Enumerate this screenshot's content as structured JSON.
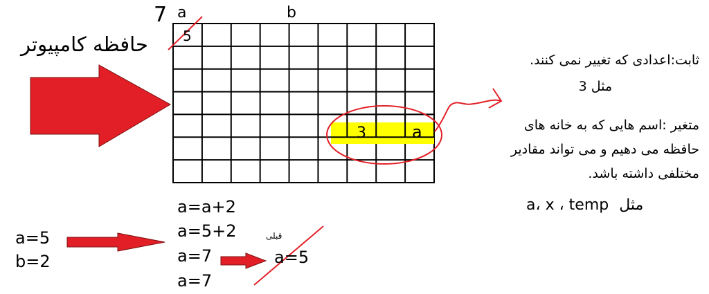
{
  "memory": {
    "label": "حافظه کامپیوتر",
    "top_number": "7",
    "var_a": "a",
    "var_b": "b",
    "crossed_value": "5",
    "yellow_const": "3",
    "yellow_var": "a"
  },
  "definitions": {
    "constant_line1": "ثابت:اعدادی که تغییر نمی کنند.",
    "constant_line2": "مثل 3",
    "variable_line1": "متغیر :اسم هایی که به خانه های",
    "variable_line2": "حافظه  می دهیم و می تواند مقادیر",
    "variable_line3": "مختلفی داشته باشد.",
    "example_prefix": "مثل",
    "example_vars": "a، x ، temp"
  },
  "code": {
    "init_line1": "a=5",
    "init_line2": "b=2",
    "steps": [
      "a=a+2",
      "a=5+2",
      "a=7",
      "a=7"
    ],
    "previous_label": "قبلی",
    "previous_value": "a=5"
  },
  "colors": {
    "arrow_red": "#e21f26",
    "highlight_yellow": "#ffff00",
    "ellipse_red": "#e21f26"
  }
}
